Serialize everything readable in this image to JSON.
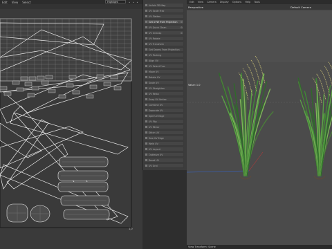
{
  "uv_editor": {
    "menu": [
      "Edit",
      "View",
      "Select"
    ],
    "dropdown": "Highlight",
    "coord_label": "1,0"
  },
  "tool_panel": {
    "items": [
      {
        "label": "Unfold 3D Map",
        "icon": "unfold-icon"
      },
      {
        "label": "UV Scale Frac",
        "icon": "scale-icon"
      },
      {
        "label": "UV Flatten",
        "icon": "flatten-icon"
      },
      {
        "label": "Get UVW From Projection",
        "icon": "projection-icon"
      },
      {
        "label": "UV Quick Clean",
        "icon": "clean-icon"
      },
      {
        "label": "UV Unwrap",
        "icon": "unwrap-icon"
      },
      {
        "label": "UV Rotate",
        "icon": "rotate-icon"
      },
      {
        "label": "UV Transform",
        "icon": "transform-icon"
      },
      {
        "label": "Get Seams From Projection",
        "icon": "seams-icon"
      },
      {
        "label": "UV Packing",
        "icon": "pack-icon"
      },
      {
        "label": "Align UV",
        "icon": "align-icon"
      },
      {
        "label": "UV Select Frac",
        "icon": "select-icon"
      },
      {
        "label": "Move UV",
        "icon": "move-icon"
      },
      {
        "label": "Rotate UV",
        "icon": "rotate-uv-icon"
      },
      {
        "label": "Scale UV",
        "icon": "scale-uv-icon"
      },
      {
        "label": "UV Straighten",
        "icon": "straighten-icon"
      },
      {
        "label": "UV Relax",
        "icon": "relax-icon"
      },
      {
        "label": "Snap UV Vertex",
        "icon": "snap-icon"
      },
      {
        "label": "Combine UV",
        "icon": "combine-icon"
      },
      {
        "label": "Separate UV",
        "icon": "separate-icon"
      },
      {
        "label": "Split UV Edge",
        "icon": "split-icon"
      },
      {
        "label": "UV Flip",
        "icon": "flip-icon"
      },
      {
        "label": "UV Mirror",
        "icon": "mirror-icon"
      },
      {
        "label": "Stitch UV",
        "icon": "stitch-icon"
      },
      {
        "label": "Sew UV Edge",
        "icon": "sew-icon"
      },
      {
        "label": "Weld UV",
        "icon": "weld-icon"
      },
      {
        "label": "UV Layout",
        "icon": "layout-icon"
      },
      {
        "label": "Optimize UV",
        "icon": "optimize-icon"
      },
      {
        "label": "Reset UV",
        "icon": "reset-icon"
      },
      {
        "label": "UV Grid",
        "icon": "grid-icon"
      }
    ]
  },
  "viewport": {
    "menu": [
      "Edit",
      "View",
      "Camera",
      "Display",
      "Options",
      "Help",
      "Tools"
    ],
    "perspective_label": "Perspective",
    "camera_label": "Default Camera",
    "value_label": "Value: 1.0",
    "transform_label": "View Transform: Scene"
  }
}
